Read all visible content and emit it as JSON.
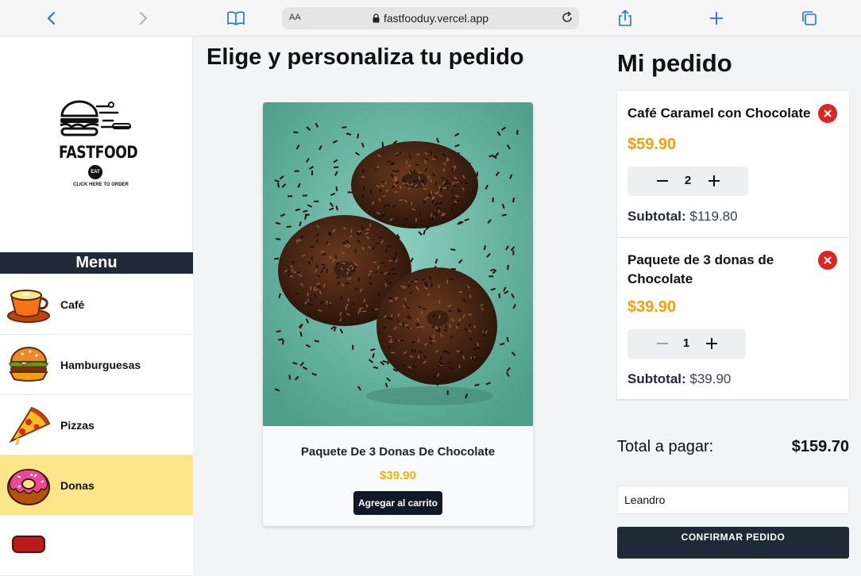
{
  "browser": {
    "text_size_label": "AA",
    "url": "fastfooduy.vercel.app"
  },
  "sidebar": {
    "logo": {
      "brand": "FASTFOOD",
      "badge": "EAT",
      "tagline": "CLICK HERE TO ORDER"
    },
    "menu_title": "Menu",
    "categories": [
      {
        "label": "Café",
        "icon": "coffee-cup-icon",
        "active": false
      },
      {
        "label": "Hamburguesas",
        "icon": "burger-icon",
        "active": false
      },
      {
        "label": "Pizzas",
        "icon": "pizza-slice-icon",
        "active": false
      },
      {
        "label": "Donas",
        "icon": "donut-icon",
        "active": true
      }
    ]
  },
  "main": {
    "title": "Elige y personaliza tu pedido",
    "product": {
      "name": "Paquete De 3 Donas De Chocolate",
      "price": "$39.90",
      "add_label": "Agregar al carrito"
    }
  },
  "order": {
    "title": "Mi pedido",
    "items": [
      {
        "name": "Café Caramel con Chocolate",
        "price": "$59.90",
        "qty": "2",
        "subtotal_label": "Subtotal:",
        "subtotal": "$119.80"
      },
      {
        "name": "Paquete de 3 donas de Chocolate",
        "price": "$39.90",
        "qty": "1",
        "subtotal_label": "Subtotal:",
        "subtotal": "$39.90"
      }
    ],
    "total_label": "Total a pagar:",
    "total": "$159.70",
    "customer_name": "Leandro",
    "confirm_label": "CONFIRMAR PEDIDO"
  },
  "colors": {
    "accent_yellow": "#f59e0b",
    "active_category": "#fde68a",
    "dark": "#1f2937",
    "remove_red": "#dc2626"
  }
}
